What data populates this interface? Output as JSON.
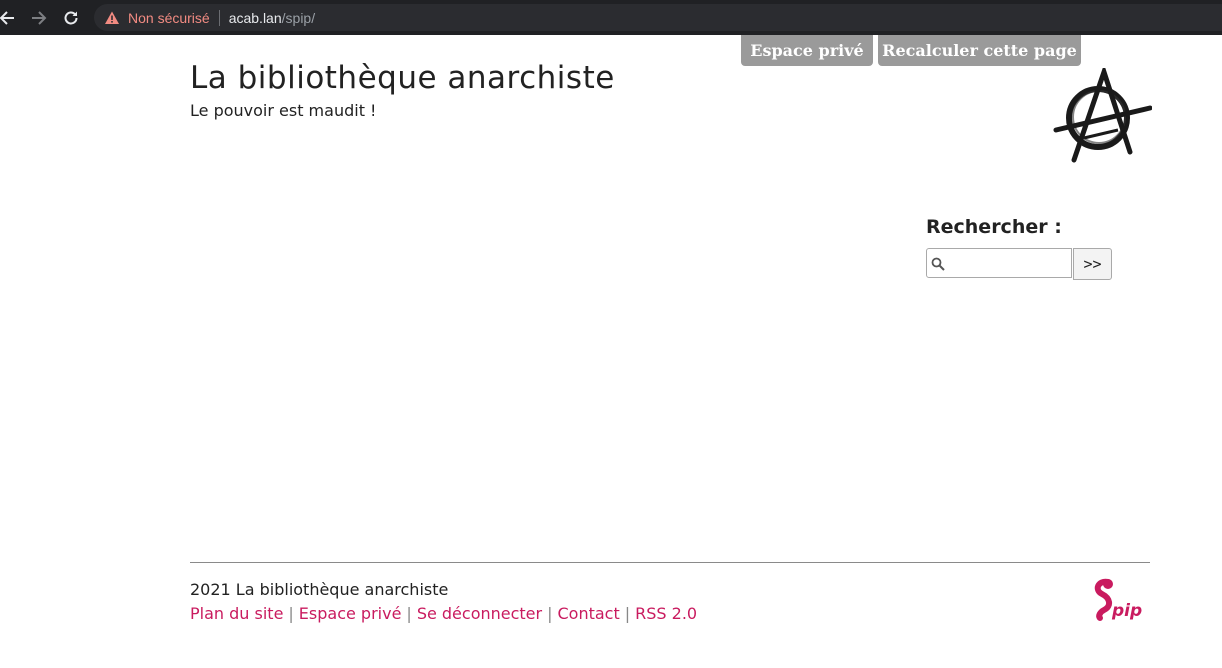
{
  "browser": {
    "back_icon": "arrow-left-icon",
    "forward_icon": "arrow-right-icon",
    "reload_icon": "reload-icon",
    "security_icon": "warning-triangle-icon",
    "security_label": "Non sécurisé",
    "url_host": "acab.lan",
    "url_path": "/spip/",
    "warning_color": "#f28b82"
  },
  "admin": {
    "private_space_label": "Espace privé",
    "recalc_label": "Recalculer cette page"
  },
  "header": {
    "title": "La bibliothèque anarchiste",
    "slogan": "Le pouvoir est maudit !",
    "logo_icon": "anarchy-symbol-logo"
  },
  "search": {
    "label": "Rechercher :",
    "placeholder": "",
    "value": "",
    "submit_label": ">>",
    "icon": "magnifier-icon"
  },
  "footer": {
    "copyright": "2021 La bibliothèque anarchiste",
    "links": [
      "Plan du site",
      "Espace privé",
      "Se déconnecter",
      "Contact",
      "RSS 2.0"
    ],
    "separator": "|",
    "link_color": "#c91b5f",
    "logo_icon": "spip-logo"
  }
}
